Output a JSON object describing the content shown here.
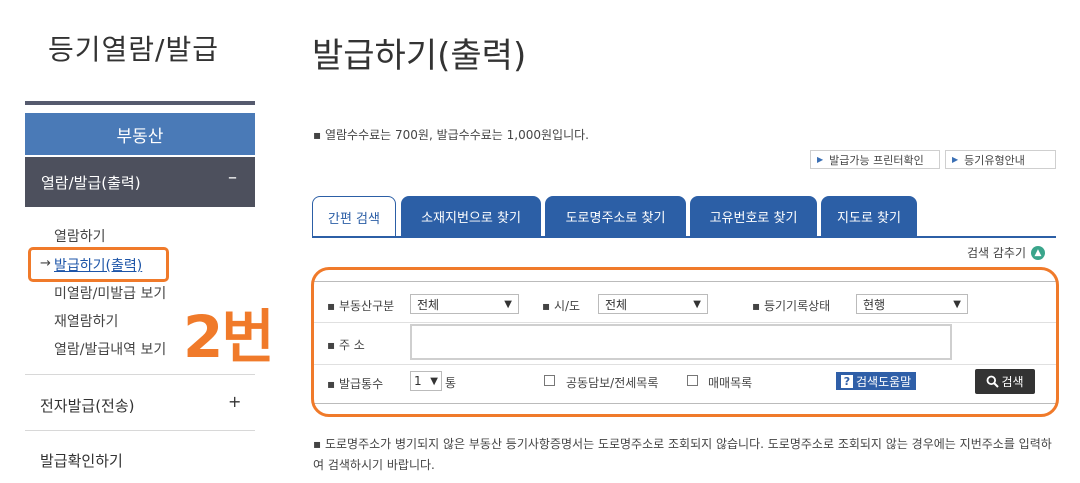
{
  "sidebar": {
    "title": "등기열람/발급",
    "category": "부동산",
    "active_section": "열람/발급(출력)",
    "active_toggle": "–",
    "arrow": "→",
    "subitems": [
      "열람하기",
      "발급하기(출력)",
      "미열람/미발급 보기",
      "재열람하기",
      "열람/발급내역 보기"
    ],
    "items": [
      "전자발급(전송)",
      "발급확인하기"
    ],
    "item_toggle": "+",
    "annotation": "2번"
  },
  "main": {
    "title": "발급하기(출력)",
    "fee_info": "▪ 열람수수료는 700원, 발급수수료는 1,000원입니다.",
    "small_buttons": [
      "발급가능 프린터확인",
      "등기유형안내"
    ],
    "tabs": [
      "간편 검색",
      "소재지번으로 찾기",
      "도로명주소로 찾기",
      "고유번호로 찾기",
      "지도로 찾기"
    ],
    "search_toggle": "검색 감추기",
    "form": {
      "type_label": "▪ 부동산구분",
      "type_value": "전체",
      "sido_label": "▪ 시/도",
      "sido_value": "전체",
      "status_label": "▪ 등기기록상태",
      "status_value": "현행",
      "address_label": "▪ 주 소",
      "address_value": "",
      "copies_label": "▪ 발급통수",
      "copies_value": "1",
      "copies_unit": "통",
      "check1_label": "공동담보/전세목록",
      "check2_label": "매매목록",
      "help_label": "검색도움말",
      "search_label": "검색"
    },
    "note": "▪ 도로명주소가 병기되지 않은 부동산 등기사항증명서는 도로명주소로 조회되지 않습니다. 도로명주소로 조회되지 않는 경우에는 지번주소를 입력하여 검색하시기 바랍니다."
  }
}
